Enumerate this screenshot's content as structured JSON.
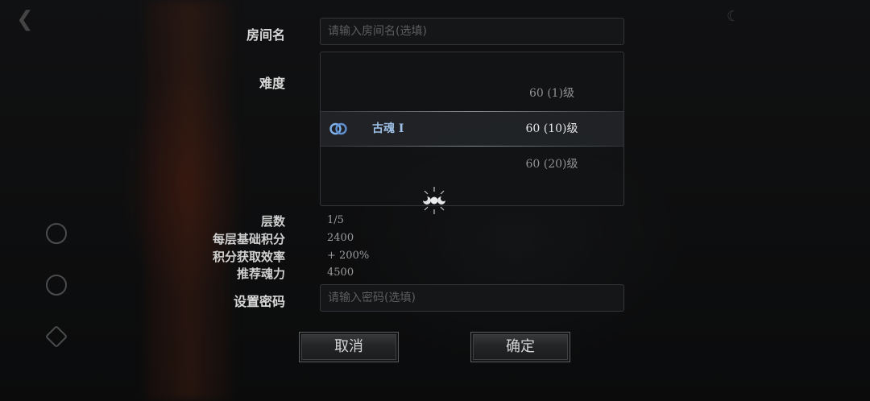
{
  "form": {
    "room_name_label": "房间名",
    "room_name_placeholder": "请输入房间名(选填)",
    "difficulty_label": "难度",
    "password_label": "设置密码",
    "password_placeholder": "请输入密码(选填)"
  },
  "difficulty_options": [
    {
      "name": "",
      "level": "60 (1)级",
      "selected": false
    },
    {
      "name": "古魂 I",
      "level": "60 (10)级",
      "selected": true,
      "icon": "infinity-rune-icon"
    },
    {
      "name": "",
      "level": "60 (20)级",
      "selected": false
    }
  ],
  "stats": [
    {
      "label": "层数",
      "value": "1/5"
    },
    {
      "label": "每层基础积分",
      "value": "2400"
    },
    {
      "label": "积分获取效率",
      "value": "+ 200%"
    },
    {
      "label": "推荐魂力",
      "value": "4500"
    }
  ],
  "buttons": {
    "cancel": "取消",
    "confirm": "确定"
  },
  "colors": {
    "selected_name": "#9ec0e6",
    "background": "#141516"
  }
}
